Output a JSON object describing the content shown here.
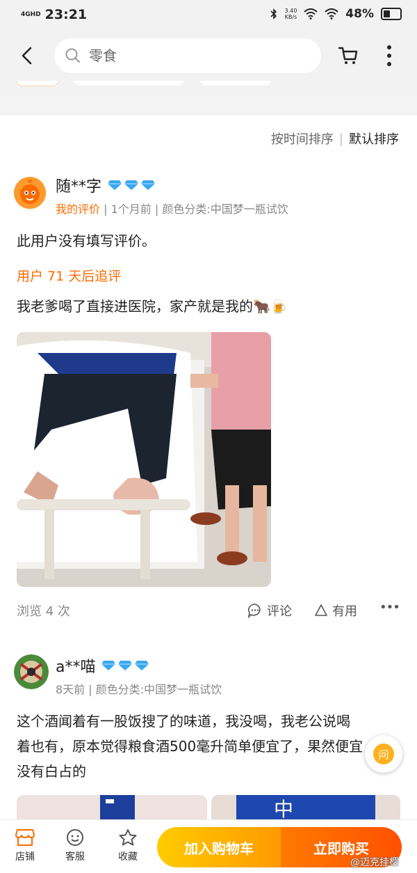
{
  "status": {
    "network": "4GHD",
    "time": "23:21",
    "speed": "3.40\nKB/s",
    "battery": "48%",
    "battery_level": 0.48
  },
  "search": {
    "placeholder": "零食"
  },
  "sort": {
    "by_time": "按时间排序",
    "default": "默认排序",
    "divider": "|"
  },
  "reviews": [
    {
      "user": "随**字",
      "tag": "我的评价",
      "meta": " | 1个月前 | 颜色分类:中国梦一瓶试饮",
      "text": "此用户没有填写评价。",
      "followup_label": "用户 71 天后追评",
      "followup_text": "我老爹喝了直接进医院，家产就是我的🐂🍺",
      "views": "浏览 4 次",
      "comment": "评论",
      "useful": "有用",
      "more": "•••"
    },
    {
      "user": "a**喵",
      "meta": "8天前 | 颜色分类:中国梦一瓶试饮",
      "text_lines": [
        "这个酒闻着有一股饭搜了的味道，我没喝，我老公说喝",
        "着也有，原本觉得粮食酒500毫升简单便宜了，果然便宜",
        "没有白占的"
      ]
    }
  ],
  "ask_button": "问",
  "bottom": {
    "shop": "店铺",
    "service": "客服",
    "favorite": "收藏",
    "add_cart": "加入购物车",
    "buy_now": "立即购买"
  },
  "watermark": "@迈克挂樱",
  "colors": {
    "accent": "#ff6a00",
    "cart_btn": "#ffb300",
    "buy_btn": "#ff5000",
    "diamond": "#39a8f0"
  }
}
